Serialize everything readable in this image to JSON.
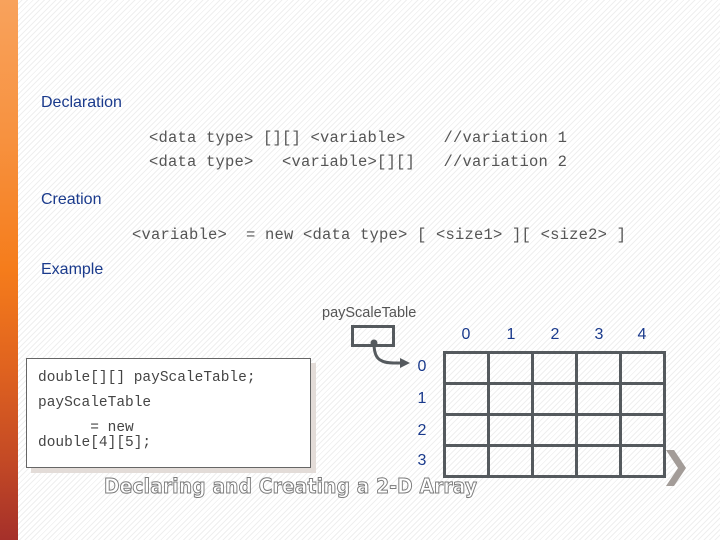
{
  "slide": {
    "sections": {
      "declaration": "Declaration",
      "creation": "Creation",
      "example": "Example"
    },
    "declaration_lines": [
      "<data type> [][] <variable>    //variation 1",
      "<data type>   <variable>[][]   //variation 2"
    ],
    "creation_line": "<variable>  = new <data type> [ <size1> ][ <size2> ]",
    "example_code": {
      "line1": "double[][] payScaleTable;",
      "line2": "payScaleTable",
      "line3": "      = new",
      "line4": "double[4][5];"
    },
    "diagram": {
      "variable_label": "payScaleTable",
      "column_indices": [
        "0",
        "1",
        "2",
        "3",
        "4"
      ],
      "row_indices": [
        "0",
        "1",
        "2",
        "3"
      ],
      "rows": 4,
      "columns": 5
    },
    "caption": "Declaring and Creating a 2-D Array",
    "icons": {
      "next": "chevron-right-icon",
      "pointer": "arrow-pointer-icon"
    },
    "colors": {
      "heading": "#1a3a8c",
      "accent_bar_top": "#f8a25c",
      "accent_bar_bottom": "#a5302a",
      "grid_line": "#555a5e",
      "chevron": "#a39c98"
    }
  }
}
